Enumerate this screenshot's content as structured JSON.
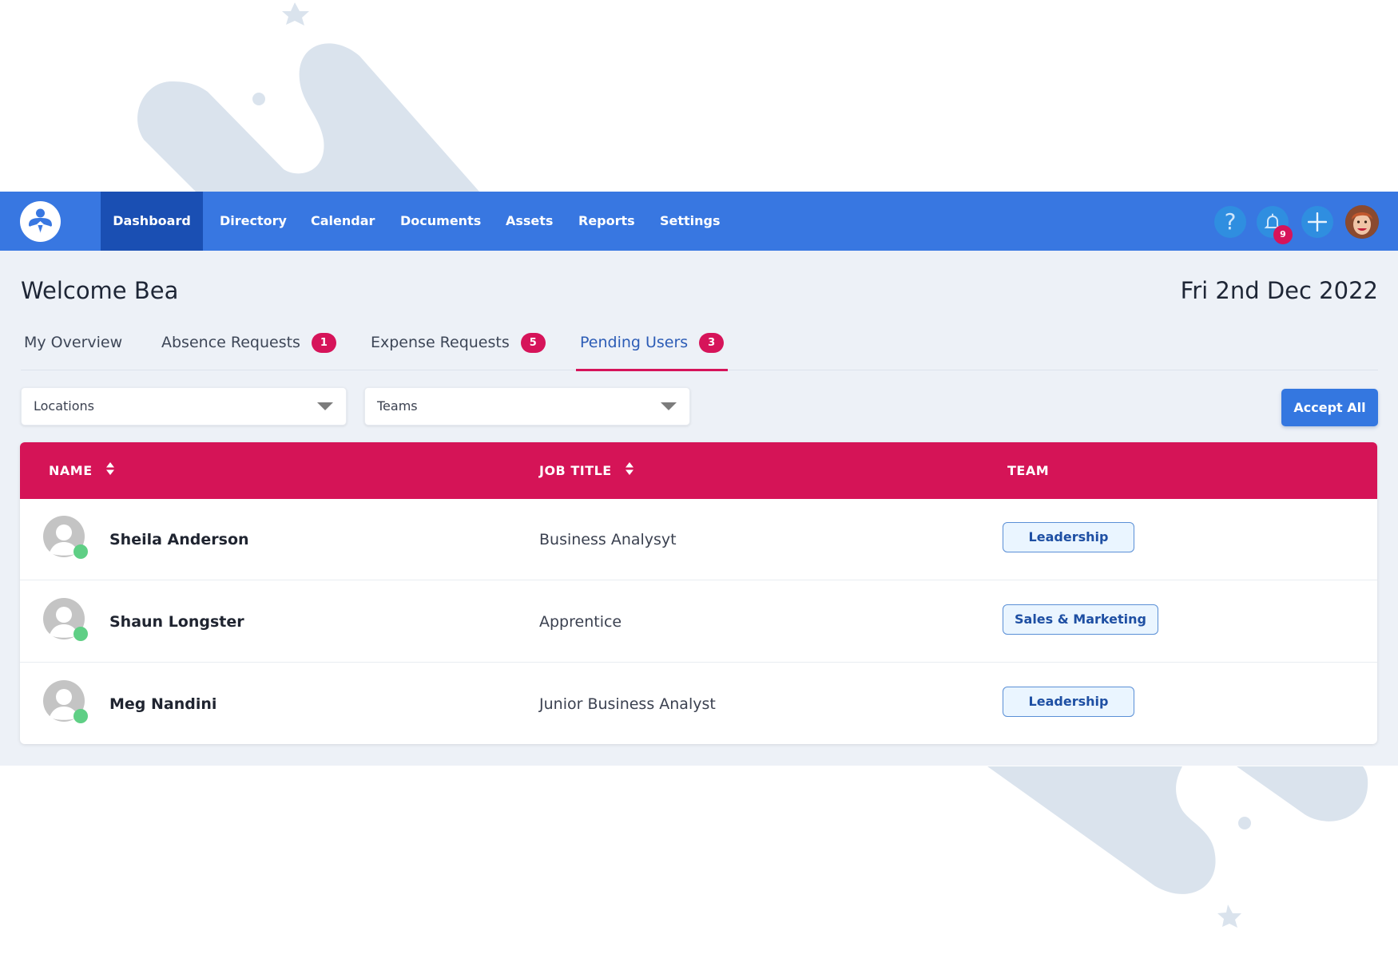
{
  "colors": {
    "navbar": "#3877e1",
    "navbar_active": "#1a4fb3",
    "accent_pink": "#d6145a",
    "tag_border": "#5a8fd6",
    "tag_text": "#1e4fa3",
    "status_online": "#5fcf85"
  },
  "navbar": {
    "logo_icon": "person-logo-icon",
    "items": [
      {
        "label": "Dashboard",
        "active": true
      },
      {
        "label": "Directory",
        "active": false
      },
      {
        "label": "Calendar",
        "active": false
      },
      {
        "label": "Documents",
        "active": false
      },
      {
        "label": "Assets",
        "active": false
      },
      {
        "label": "Reports",
        "active": false
      },
      {
        "label": "Settings",
        "active": false
      }
    ],
    "actions": {
      "help_icon": "question-mark-icon",
      "help_glyph": "?",
      "notifications_icon": "bell-icon",
      "notifications_count": "9",
      "add_icon": "plus-icon",
      "user_avatar": "user-avatar"
    }
  },
  "page": {
    "welcome": "Welcome Bea",
    "date": "Fri 2nd Dec 2022"
  },
  "tabs": [
    {
      "label": "My Overview",
      "badge": null,
      "active": false
    },
    {
      "label": "Absence Requests",
      "badge": "1",
      "active": false
    },
    {
      "label": "Expense Requests",
      "badge": "5",
      "active": false
    },
    {
      "label": "Pending Users",
      "badge": "3",
      "active": true
    }
  ],
  "filters": {
    "locations": {
      "placeholder": "Locations"
    },
    "teams": {
      "placeholder": "Teams"
    }
  },
  "actions": {
    "accept_all": "Accept All"
  },
  "table": {
    "columns": [
      {
        "label": "NAME",
        "sortable": true
      },
      {
        "label": "JOB TITLE",
        "sortable": true
      },
      {
        "label": "TEAM",
        "sortable": false
      }
    ],
    "rows": [
      {
        "name": "Sheila Anderson",
        "job_title": "Business Analysyt",
        "team": "Leadership",
        "status": "online"
      },
      {
        "name": "Shaun Longster",
        "job_title": "Apprentice",
        "team": "Sales & Marketing",
        "status": "online"
      },
      {
        "name": "Meg Nandini",
        "job_title": "Junior Business Analyst",
        "team": "Leadership",
        "status": "online"
      }
    ]
  }
}
